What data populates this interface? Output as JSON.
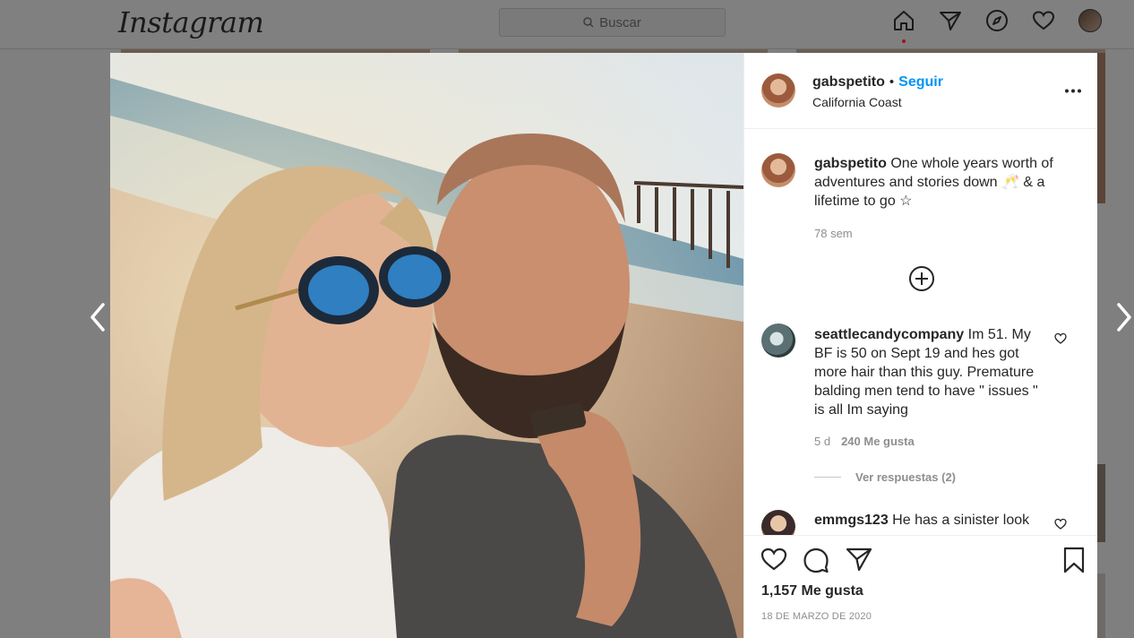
{
  "nav": {
    "logo": "Instagram",
    "search_placeholder": "Buscar"
  },
  "post": {
    "author": "gabspetito",
    "separator": "•",
    "follow_label": "Seguir",
    "location": "California Coast",
    "more_label": "•••",
    "caption_user": "gabspetito",
    "caption_text": "One whole years worth of adventures and stories down 🥂 & a lifetime to go ☆",
    "caption_age": "78 sem",
    "likes": "1,157 Me gusta",
    "date": "18 DE MARZO DE 2020"
  },
  "comments": [
    {
      "user": "seattlecandycompany",
      "text": "Im 51. My BF is 50 on Sept 19 and hes got more hair than this guy. Premature balding men tend to have \" issues \" is all Im saying",
      "age": "5 d",
      "likes": "240 Me gusta",
      "replies": "Ver respuestas (2)"
    },
    {
      "user": "emmgs123",
      "text": "He has a sinister look"
    }
  ],
  "icons": [
    "home-icon",
    "direct-icon",
    "explore-icon",
    "heart-icon",
    "search-icon",
    "add-comment-icon",
    "like-icon",
    "comment-icon",
    "share-icon",
    "save-icon",
    "chevron-left-icon",
    "chevron-right-icon",
    "more-icon"
  ],
  "colors": {
    "accent": "#0095f6",
    "overlay": "#7f7f7f",
    "notification": "#ed4956"
  }
}
